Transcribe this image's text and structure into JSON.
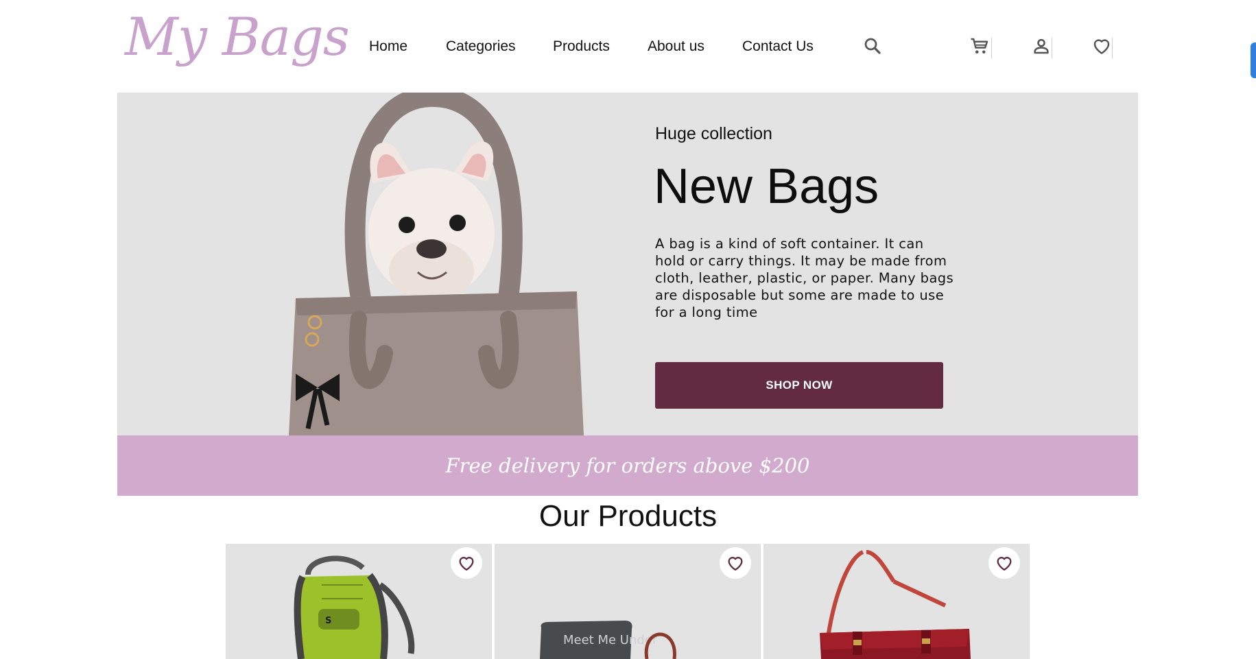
{
  "brand": {
    "logo_text": "My Bags"
  },
  "nav": {
    "items": [
      "Home",
      "Categories",
      "Products",
      "About us",
      "Contact Us"
    ]
  },
  "header_icons": [
    "search-icon",
    "cart-icon",
    "user-icon",
    "heart-icon"
  ],
  "hero": {
    "subtitle": "Huge collection",
    "title": "New Bags",
    "text": "A bag is a kind of soft container. It can hold or carry things. It may be made from cloth, leather, plastic, or paper. Many bags are disposable but some are made to use for a long time",
    "button_label": "SHOP NOW"
  },
  "banner": {
    "text": "Free delivery for orders above $200"
  },
  "products": {
    "title": "Our Products",
    "cards": [
      {
        "image": "green-backpack",
        "fav_icon": "heart-icon"
      },
      {
        "image": "pillow-and-handbag",
        "fav_icon": "heart-icon",
        "image_text": "Meet Me Under"
      },
      {
        "image": "red-satchel",
        "fav_icon": "heart-icon"
      }
    ]
  },
  "colors": {
    "brand_pink": "#c8a2cc",
    "hero_bg": "#e4e3e4",
    "button_bg": "#632b3f",
    "banner_bg": "#d2aacd",
    "heart_stroke": "#5e2b40"
  }
}
